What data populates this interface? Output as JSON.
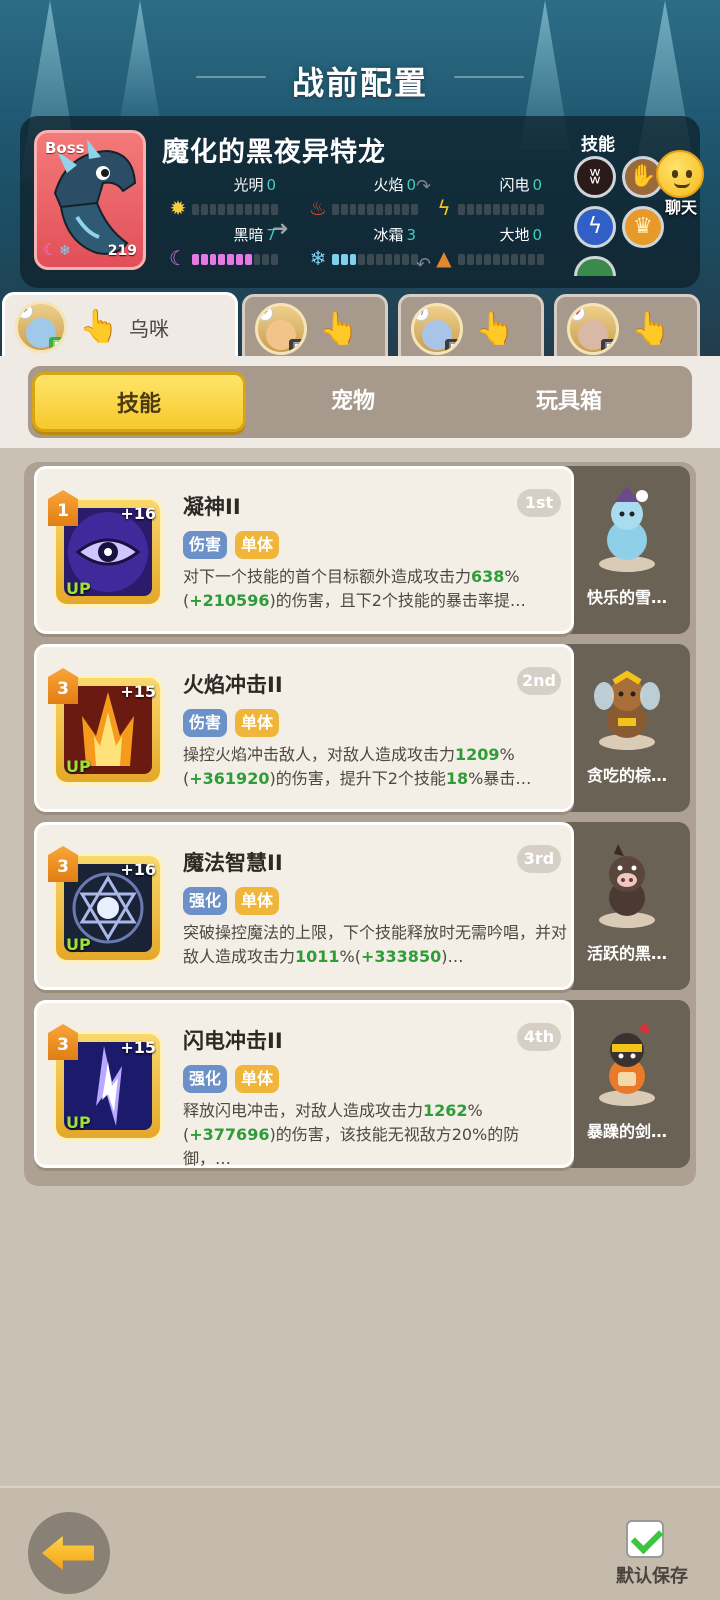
{
  "header": {
    "title": "战前配置"
  },
  "boss": {
    "tag": "Boss",
    "name": "魔化的黑夜异特龙",
    "level": "219",
    "elements": [
      {
        "id": "light",
        "label": "光明",
        "value": "0",
        "icon": "sun-icon"
      },
      {
        "id": "fire",
        "label": "火焰",
        "value": "0",
        "icon": "fire-icon"
      },
      {
        "id": "thunder",
        "label": "闪电",
        "value": "0",
        "icon": "lightning-icon"
      },
      {
        "id": "dark",
        "label": "黑暗",
        "value": "7",
        "icon": "moon-icon"
      },
      {
        "id": "frost",
        "label": "冰霜",
        "value": "3",
        "icon": "snowflake-icon"
      },
      {
        "id": "earth",
        "label": "大地",
        "value": "0",
        "icon": "earth-icon"
      }
    ],
    "skills_label": "技能"
  },
  "chat": {
    "label": "聊天"
  },
  "characters": [
    {
      "name": "乌咪",
      "active": true
    },
    {
      "name": "",
      "active": false
    },
    {
      "name": "",
      "active": false
    },
    {
      "name": "",
      "active": false
    }
  ],
  "segments": {
    "skills": "技能",
    "pets": "宠物",
    "toybox": "玩具箱",
    "active": "技能"
  },
  "skills": [
    {
      "title": "凝神II",
      "rank": "1st",
      "level": "1",
      "plus": "+16",
      "up": "UP",
      "tags": [
        "伤害",
        "单体"
      ],
      "desc_a": "对下一个技能的首个目标额外造成攻击力",
      "desc_b": "638",
      "desc_c": "%(",
      "desc_d": "+210596",
      "desc_e": ")的伤害，且下2个技能的暴击率提…",
      "pet": "快乐的雪…"
    },
    {
      "title": "火焰冲击II",
      "rank": "2nd",
      "level": "3",
      "plus": "+15",
      "up": "UP",
      "tags": [
        "伤害",
        "单体"
      ],
      "desc_a": "操控火焰冲击敌人，对敌人造成攻击力",
      "desc_b": "1209",
      "desc_c": "%(",
      "desc_d": "+361920",
      "desc_e": ")的伤害，提升下2个技能",
      "desc_f": "18",
      "desc_g": "%暴击…",
      "pet": "贪吃的棕…"
    },
    {
      "title": "魔法智慧II",
      "rank": "3rd",
      "level": "3",
      "plus": "+16",
      "up": "UP",
      "tags": [
        "强化",
        "单体"
      ],
      "desc_a": "突破操控魔法的上限，下个技能释放时无需吟唱，并对敌人造成攻击力",
      "desc_b": "1011",
      "desc_c": "%(",
      "desc_d": "+333850",
      "desc_e": ")…",
      "pet": "活跃的黑…"
    },
    {
      "title": "闪电冲击II",
      "rank": "4th",
      "level": "3",
      "plus": "+15",
      "up": "UP",
      "tags": [
        "强化",
        "单体"
      ],
      "desc_a": "释放闪电冲击，对敌人造成攻击力",
      "desc_b": "1262",
      "desc_c": "%(",
      "desc_d": "+377696",
      "desc_e": ")的伤害，该技能无视敌方20%的防御，…",
      "pet": "暴躁的剑…"
    }
  ],
  "footer": {
    "save_label": "默认保存",
    "save_checked": true
  },
  "colors": {
    "accent_yellow": "#f6c92c",
    "green_value": "#2f9c3a",
    "dark_bar": "#e57ae5",
    "frost_bar": "#7fd0ef"
  }
}
